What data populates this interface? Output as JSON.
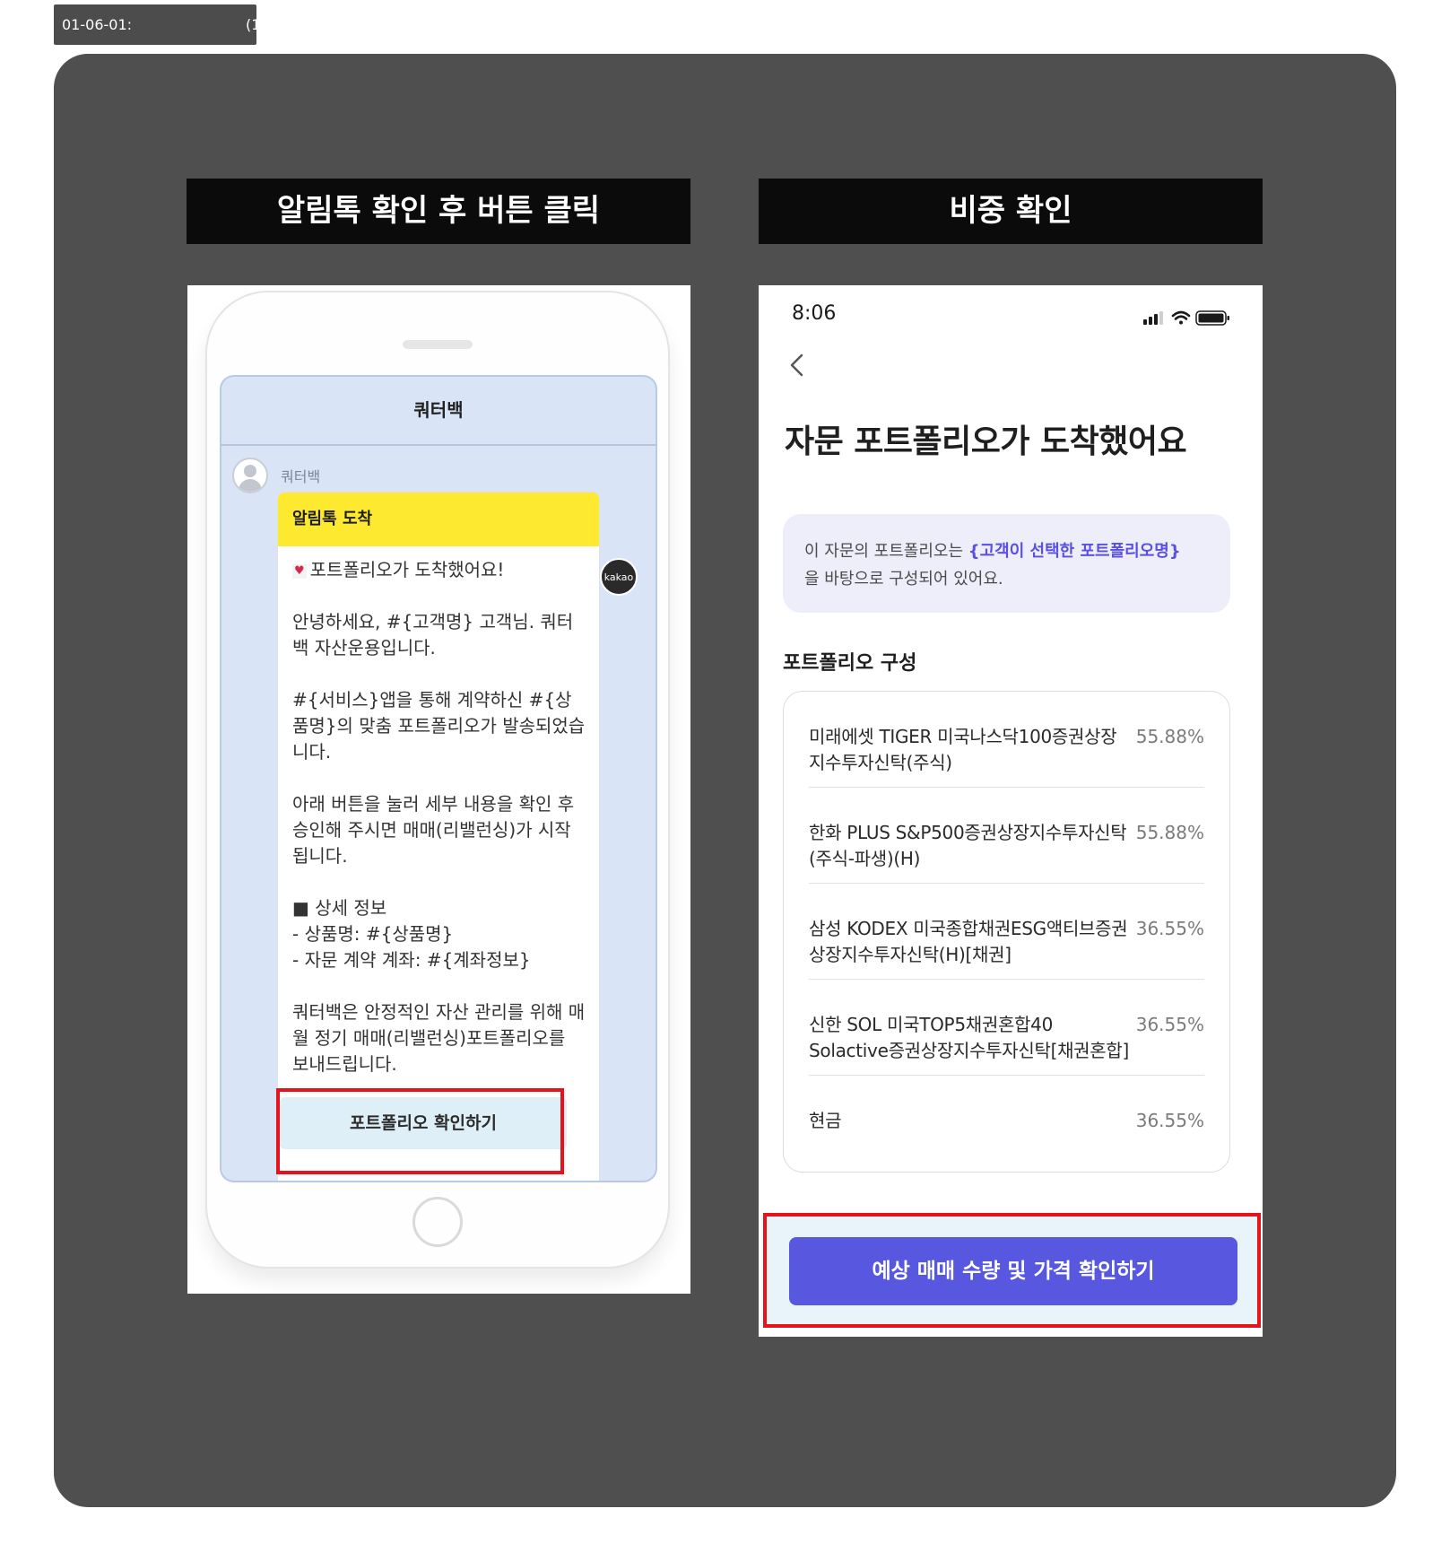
{
  "frame_label": {
    "code": "01-06-01:",
    "suffix": "(1"
  },
  "steps": [
    {
      "header": "알림톡 확인 후 버튼 클릭"
    },
    {
      "header": "비중 확인"
    }
  ],
  "left_phone": {
    "chat_title": "쿼터백",
    "sender_name": "쿼터백",
    "kakao_badge": "kakao",
    "bubble_title": "알림톡 도착",
    "heart_glyph": "♥",
    "message_lines": [
      "포트폴리오가 도착했어요!",
      "안녕하세요, #{고객명} 고객님. 쿼터백 자산운용입니다.",
      "#{서비스}앱을 통해 계약하신 #{상품명}의 맞춤 포트폴리오가 발송되었습니다.",
      "아래 버튼을 눌러 세부 내용을 확인 후 승인해 주시면 매매(리밸런싱)가 시작됩니다.",
      "■ 상세 정보",
      "- 상품명: #{상품명}",
      "- 자문 계약 계좌: #{계좌정보}",
      "쿼터백은 안정적인 자산 관리를 위해 매월 정기 매매(리밸런싱)포트폴리오를 보내드립니다."
    ],
    "button_label": "포트폴리오 확인하기"
  },
  "right_screen": {
    "status_time": "8:06",
    "title": "자문 포트폴리오가 도착했어요",
    "notice_prefix": "이 자문의 포트폴리오는 ",
    "notice_highlight": "{고객이 선택한 포트폴리오명}",
    "notice_suffix": "을 바탕으로 구성되어 있어요.",
    "section_title": "포트폴리오 구성",
    "holdings": [
      {
        "name": "미래에셋 TIGER 미국나스닥100증권상장지수투자신탁(주식)",
        "weight": "55.88%"
      },
      {
        "name": "한화 PLUS S&P500증권상장지수투자신탁(주식-파생)(H)",
        "weight": "55.88%"
      },
      {
        "name": "삼성 KODEX 미국종합채권ESG액티브증권상장지수투자신탁(H)[채권]",
        "weight": "36.55%"
      },
      {
        "name": "신한 SOL 미국TOP5채권혼합40 Solactive증권상장지수투자신탁[채권혼합]",
        "weight": "36.55%"
      },
      {
        "name": "현금",
        "weight": "36.55%"
      }
    ],
    "cta_label": "예상 매매 수량 및 가격 확인하기"
  },
  "colors": {
    "canvas": "#4f4f4f",
    "header_bg": "#0b0b0b",
    "highlight_border": "#e4131c",
    "kakao_yellow": "#fde92f",
    "chat_bg": "#d9e4f7",
    "accent_purple": "#5757df",
    "notice_bg": "#eeeefb"
  },
  "icons": [
    "signal-icon",
    "wifi-icon",
    "battery-icon",
    "back-chevron-icon",
    "profile-avatar-icon",
    "heart-icon",
    "kakao-logo-icon"
  ]
}
